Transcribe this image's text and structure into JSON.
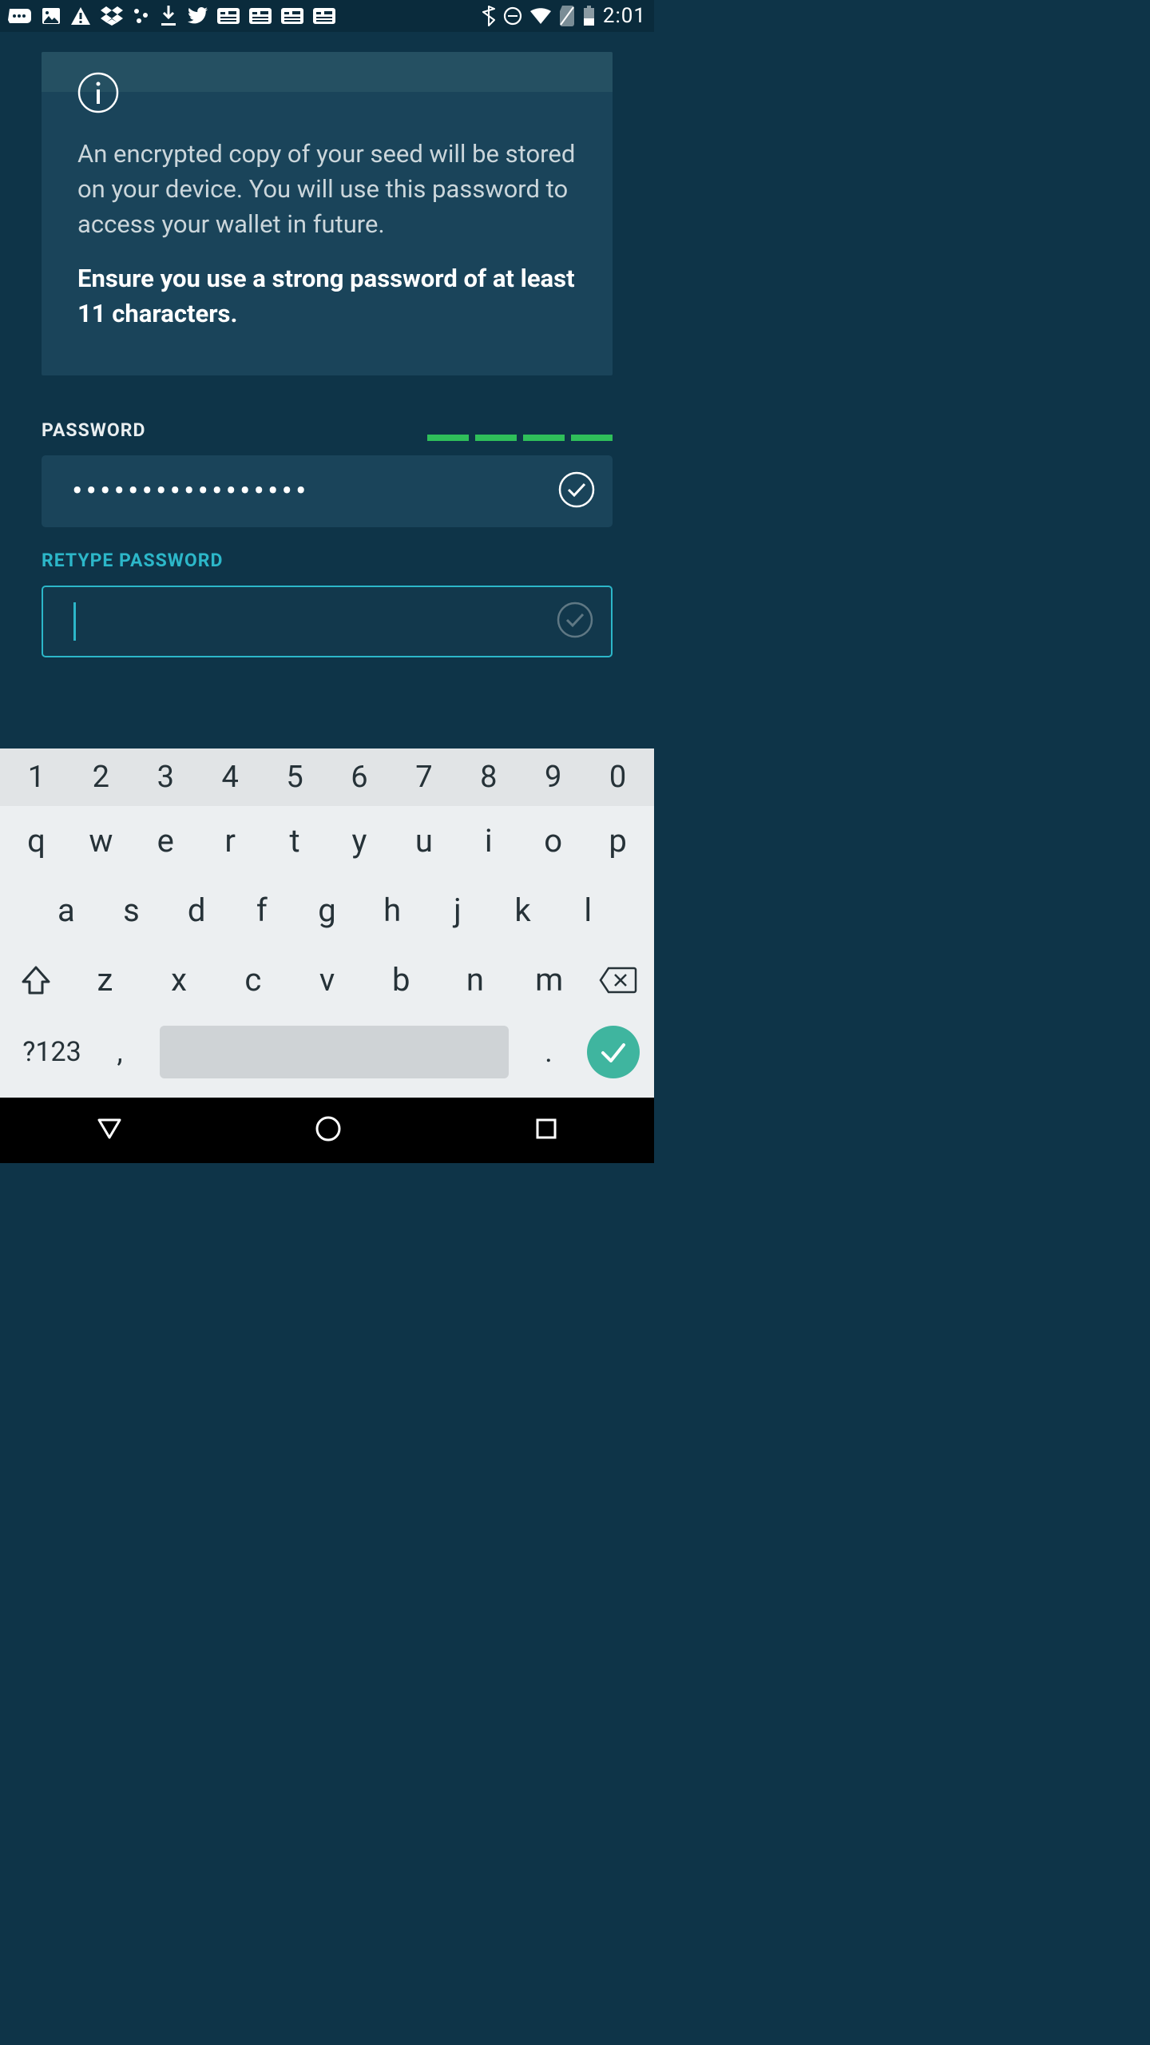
{
  "status": {
    "time": "2:01"
  },
  "info": {
    "text": "An encrypted copy of your seed will be stored on your device. You will use this password to access your wallet in future.",
    "bold": "Ensure you use a strong password of at least 11 characters."
  },
  "password": {
    "label": "PASSWORD",
    "value_mask": "•••••••••••••••••",
    "strength_segments": 4
  },
  "retype": {
    "label": "RETYPE PASSWORD",
    "value": ""
  },
  "keyboard": {
    "row_num": [
      "1",
      "2",
      "3",
      "4",
      "5",
      "6",
      "7",
      "8",
      "9",
      "0"
    ],
    "row1": [
      "q",
      "w",
      "e",
      "r",
      "t",
      "y",
      "u",
      "i",
      "o",
      "p"
    ],
    "row2": [
      "a",
      "s",
      "d",
      "f",
      "g",
      "h",
      "j",
      "k",
      "l"
    ],
    "row3": [
      "z",
      "x",
      "c",
      "v",
      "b",
      "n",
      "m"
    ],
    "sym": "?123",
    "comma": ",",
    "period": "."
  }
}
